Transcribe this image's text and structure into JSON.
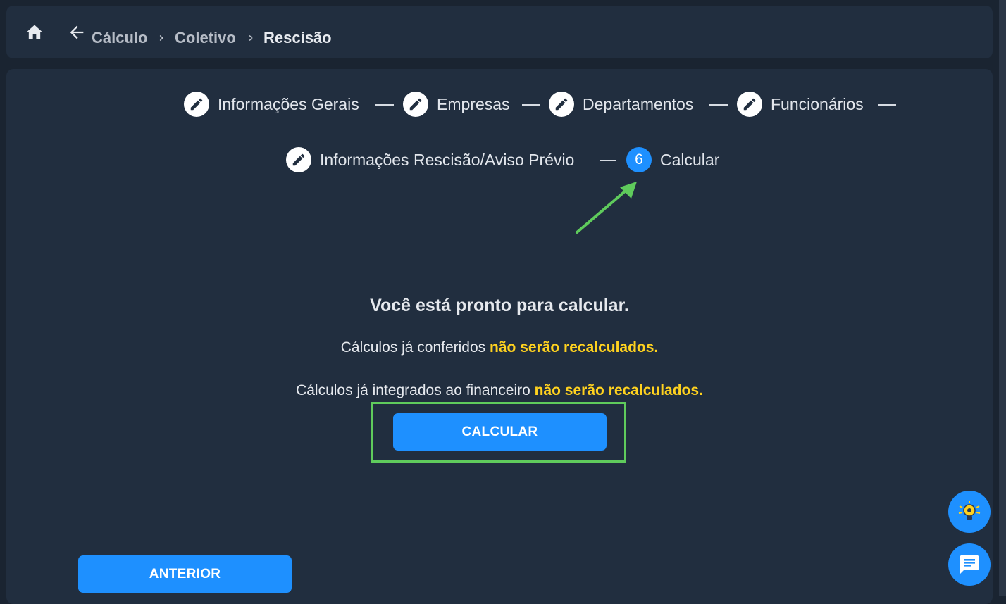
{
  "breadcrumb": {
    "items": [
      "Cálculo",
      "Coletivo",
      "Rescisão"
    ]
  },
  "stepper": {
    "steps": [
      {
        "label": "Informações Gerais",
        "icon": "pencil-icon"
      },
      {
        "label": "Empresas",
        "icon": "pencil-icon"
      },
      {
        "label": "Departamentos",
        "icon": "pencil-icon"
      },
      {
        "label": "Funcionários",
        "icon": "pencil-icon"
      },
      {
        "label": "Informações Rescisão/Aviso Prévio",
        "icon": "pencil-icon"
      },
      {
        "label": "Calcular",
        "number": "6"
      }
    ]
  },
  "main": {
    "heading": "Você está pronto para calcular.",
    "line1_text": "Cálculos já conferidos",
    "line1_warn": "não serão recalculados.",
    "line2_text": "Cálculos já integrados ao financeiro",
    "line2_warn": "não serão recalculados.",
    "calculate_button": "CALCULAR",
    "previous_button": "ANTERIOR"
  },
  "colors": {
    "background": "#1a2431",
    "panel": "#212e3f",
    "accent": "#1e90ff",
    "warning": "#ffd21f",
    "annotation": "#5fcb5c"
  },
  "fabs": [
    {
      "name": "lightbulb-icon"
    },
    {
      "name": "chat-icon"
    }
  ]
}
